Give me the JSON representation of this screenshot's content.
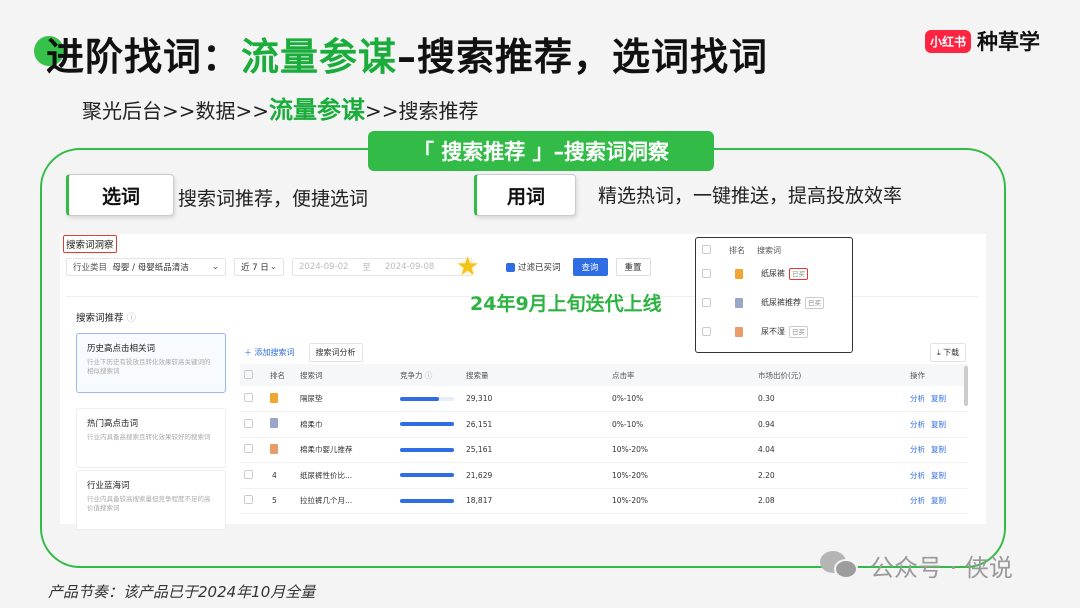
{
  "slide": {
    "title_prefix": "进阶找词：",
    "title_highlight": "流量参谋",
    "title_suffix": "–搜索推荐，选词找词",
    "path_prefix": "聚光后台>>数据>>",
    "path_highlight": "流量参谋",
    "path_suffix": ">>搜索推荐",
    "banner": "「 搜索推荐 」–搜索词洞察",
    "tag_select": "选词",
    "desc_select": "搜索词推荐，便捷选词",
    "tag_use": "用词",
    "desc_use": "精选热词，一键推送，提高投放效率",
    "annotation": "24年9月上旬迭代上线",
    "footer": "产品节奏：该产品已于2024年10月全量",
    "watermark": "公众号 · 侠说"
  },
  "brand": {
    "logo": "小红书",
    "text": "种草学"
  },
  "screen": {
    "title": "搜索词洞察",
    "filters": {
      "industry_label": "行业类目",
      "industry_value": "母婴 / 母婴纸品清洁",
      "period": "近 7 日",
      "date_start": "2024-09-02",
      "date_sep": "至",
      "date_end": "2024-09-08",
      "filter_bought": "过滤已买词",
      "query_button": "查询",
      "reset_button": "重置"
    },
    "section_title": "搜索词推荐",
    "cards": [
      {
        "title": "历史高点击相关词",
        "desc": "行业下历史有投放且转化效果较高关键词的相似搜索词"
      },
      {
        "title": "热门高点击词",
        "desc": "行业内具备高搜索且转化效果较好的搜索词"
      },
      {
        "title": "行业蓝海词",
        "desc": "行业内具备较高搜索量但竞争程度不足的高价值搜索词"
      }
    ],
    "add_word": "添加搜索词",
    "analyze": "搜索词分析",
    "download": "下载",
    "table": {
      "headers": [
        "排名",
        "搜索词",
        "竞争力",
        "搜索量",
        "点击率",
        "市场出价(元)",
        "操作"
      ],
      "rows": [
        {
          "rank": "",
          "medal": "gold",
          "word": "隔尿垫",
          "competition": 0.72,
          "volume": "29,310",
          "ctr": "0%-10%",
          "bid": "0.30"
        },
        {
          "rank": "",
          "medal": "silver",
          "word": "棉柔巾",
          "competition": 1.0,
          "volume": "26,151",
          "ctr": "0%-10%",
          "bid": "0.94"
        },
        {
          "rank": "",
          "medal": "bronze",
          "word": "棉柔巾婴儿推荐",
          "competition": 1.0,
          "volume": "25,161",
          "ctr": "10%-20%",
          "bid": "4.04"
        },
        {
          "rank": "4",
          "medal": "",
          "word": "纸尿裤性价比...",
          "competition": 1.0,
          "volume": "21,629",
          "ctr": "10%-20%",
          "bid": "2.20"
        },
        {
          "rank": "5",
          "medal": "",
          "word": "拉拉裤几个月...",
          "competition": 1.0,
          "volume": "18,817",
          "ctr": "10%-20%",
          "bid": "2.08"
        }
      ],
      "op_analyze": "分析",
      "op_copy": "复制"
    }
  },
  "popup": {
    "headers": [
      "排名",
      "搜索词"
    ],
    "rows": [
      {
        "word": "纸尿裤",
        "badge": "已买",
        "highlight": true,
        "medal": "gold"
      },
      {
        "word": "纸尿裤推荐",
        "badge": "已买",
        "highlight": false,
        "medal": "silver"
      },
      {
        "word": "尿不湿",
        "badge": "已买",
        "highlight": false,
        "medal": "bronze"
      }
    ]
  }
}
